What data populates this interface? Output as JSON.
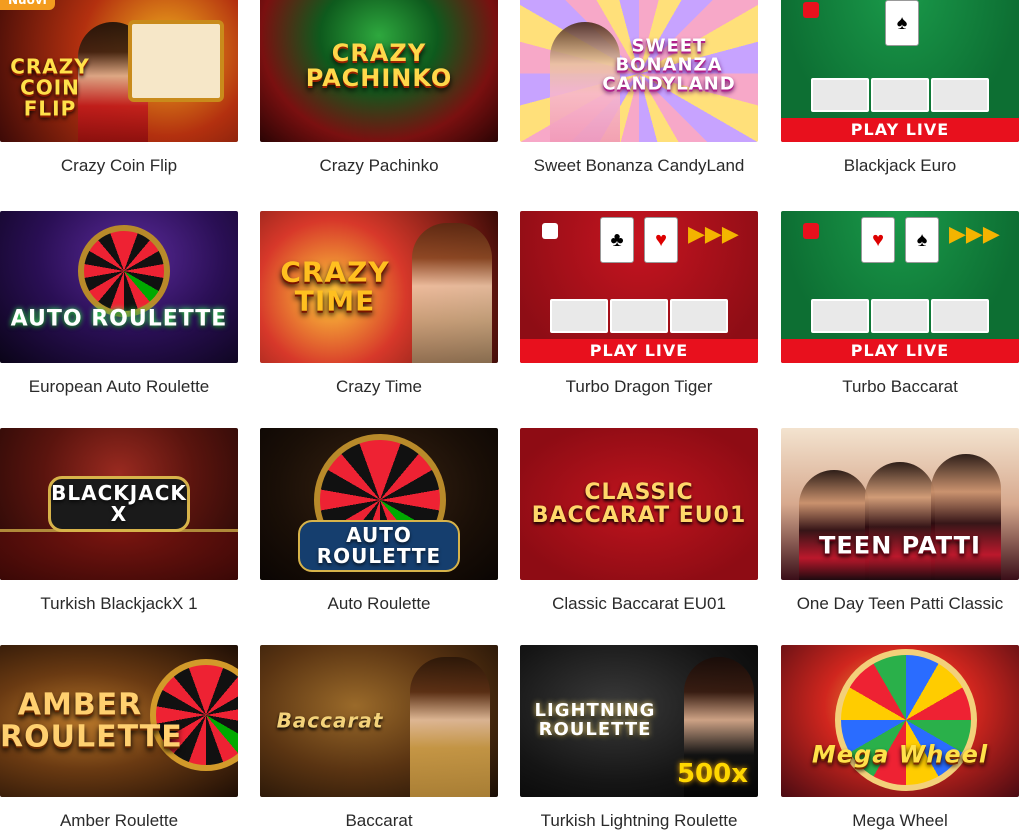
{
  "badge": "Nuovi",
  "play_live": "PLAY LIVE",
  "games": [
    {
      "name": "Crazy Coin Flip",
      "art": "CRAZY COIN FLIP"
    },
    {
      "name": "Crazy Pachinko",
      "art": "CRAZY PACHINKO"
    },
    {
      "name": "Sweet Bonanza CandyLand",
      "art": "SWEET BONANZA CANDYLAND"
    },
    {
      "name": "Blackjack Euro",
      "art": ""
    },
    {
      "name": "European Auto Roulette",
      "art": "AUTO ROULETTE"
    },
    {
      "name": "Crazy Time",
      "art": "CRAZY TIME"
    },
    {
      "name": "Turbo Dragon Tiger",
      "art": ""
    },
    {
      "name": "Turbo Baccarat",
      "art": ""
    },
    {
      "name": "Turkish BlackjackX 1",
      "art": "BLACKJACK X"
    },
    {
      "name": "Auto Roulette",
      "art": "AUTO ROULETTE"
    },
    {
      "name": "Classic Baccarat EU01",
      "art": "CLASSIC BACCARAT EU01"
    },
    {
      "name": "One Day Teen Patti Classic",
      "art": "TEEN PATTI"
    },
    {
      "name": "Amber Roulette",
      "art": "AMBER ROULETTE"
    },
    {
      "name": "Baccarat",
      "art": "Baccarat"
    },
    {
      "name": "Turkish Lightning Roulette",
      "art": "LIGHTNING ROULETTE"
    },
    {
      "name": "Mega Wheel",
      "art": "Mega Wheel"
    }
  ],
  "colors": {
    "badge": "#f39c1f",
    "play_live": "#e8101d",
    "caption_text": "#2a2a2a"
  }
}
